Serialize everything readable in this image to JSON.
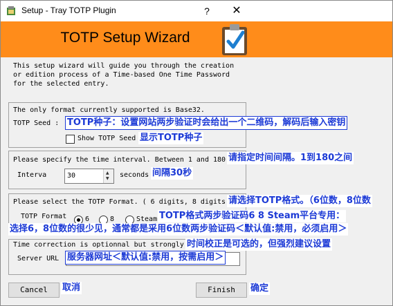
{
  "window": {
    "title": "Setup - Tray TOTP Plugin",
    "help_label": "?",
    "close_label": "✕"
  },
  "banner": {
    "title": "TOTP Setup Wizard"
  },
  "intro": {
    "text": "This setup wizard will guide you through the creation\nor edition process of a Time-based One Time Password\nfor the selected entry."
  },
  "seed_group": {
    "caption": "The only format currently supported is Base32.",
    "seed_label": "TOTP Seed :",
    "seed_value": "",
    "show_seed_label": "Show TOTP Seed",
    "show_seed_checked": false
  },
  "interval_group": {
    "caption": "Please specify the time interval. Between 1 and 180",
    "interval_label": "Interva",
    "interval_value": "30",
    "seconds_label": "seconds"
  },
  "format_group": {
    "caption": "Please select the TOTP Format. ( 6 digits, 8 digits",
    "format_label": "TOTP Format",
    "options": [
      {
        "label": "6",
        "selected": true
      },
      {
        "label": "8",
        "selected": false
      },
      {
        "label": "Steam",
        "selected": false
      }
    ]
  },
  "time_group": {
    "caption": "Time correction is optionnal but strongly",
    "server_url_label": "Server URL",
    "server_url_value": ""
  },
  "buttons": {
    "cancel": "Cancel",
    "finish": "Finish"
  },
  "annotations": {
    "seed": "TOTP种子：设置网站两步验证时会给出一个二维码，解码后输入密钥",
    "show_seed": "显示TOTP种子",
    "interval": "请指定时间间隔。1到180之间",
    "interval_unit": "间隔30秒",
    "format": "请选择TOTP格式。（6位数，8位数",
    "format_steam": "TOTP格式两步验证码6 8 Steam平台专用：",
    "format_note": "选择6，8位数的很少见，通常都是采用6位数两步验证码＜默认值:禁用，必须启用＞",
    "time": "时间校正是可选的，但强烈建议设置",
    "server_url": "服务器网址＜默认值:禁用，按需启用＞",
    "cancel": "取消",
    "finish": "确定"
  },
  "colors": {
    "banner": "#ff8c1a",
    "annotation_text": "#1c3ad6"
  }
}
